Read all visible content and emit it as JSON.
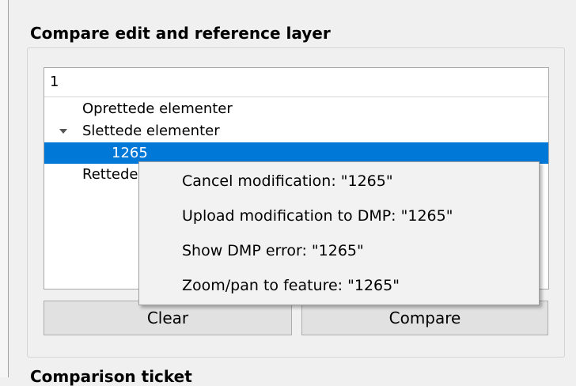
{
  "panel": {
    "title": "Compare edit and reference layer",
    "next_section_title": "Comparison ticket"
  },
  "tree": {
    "header": "1",
    "items": [
      {
        "label": "Oprettede elementer"
      },
      {
        "label": "Slettede elementer",
        "expanded": true
      },
      {
        "label": "1265",
        "selected": true
      },
      {
        "label": "Rettede elementer"
      }
    ]
  },
  "buttons": {
    "clear": "Clear",
    "compare": "Compare"
  },
  "context_menu": {
    "items": [
      "Cancel modification: \"1265\"",
      "Upload modification to DMP: \"1265\"",
      "Show DMP error: \"1265\"",
      "Zoom/pan to feature: \"1265\""
    ]
  },
  "colors": {
    "selection": "#0078d7",
    "background": "#f0f0f0"
  }
}
